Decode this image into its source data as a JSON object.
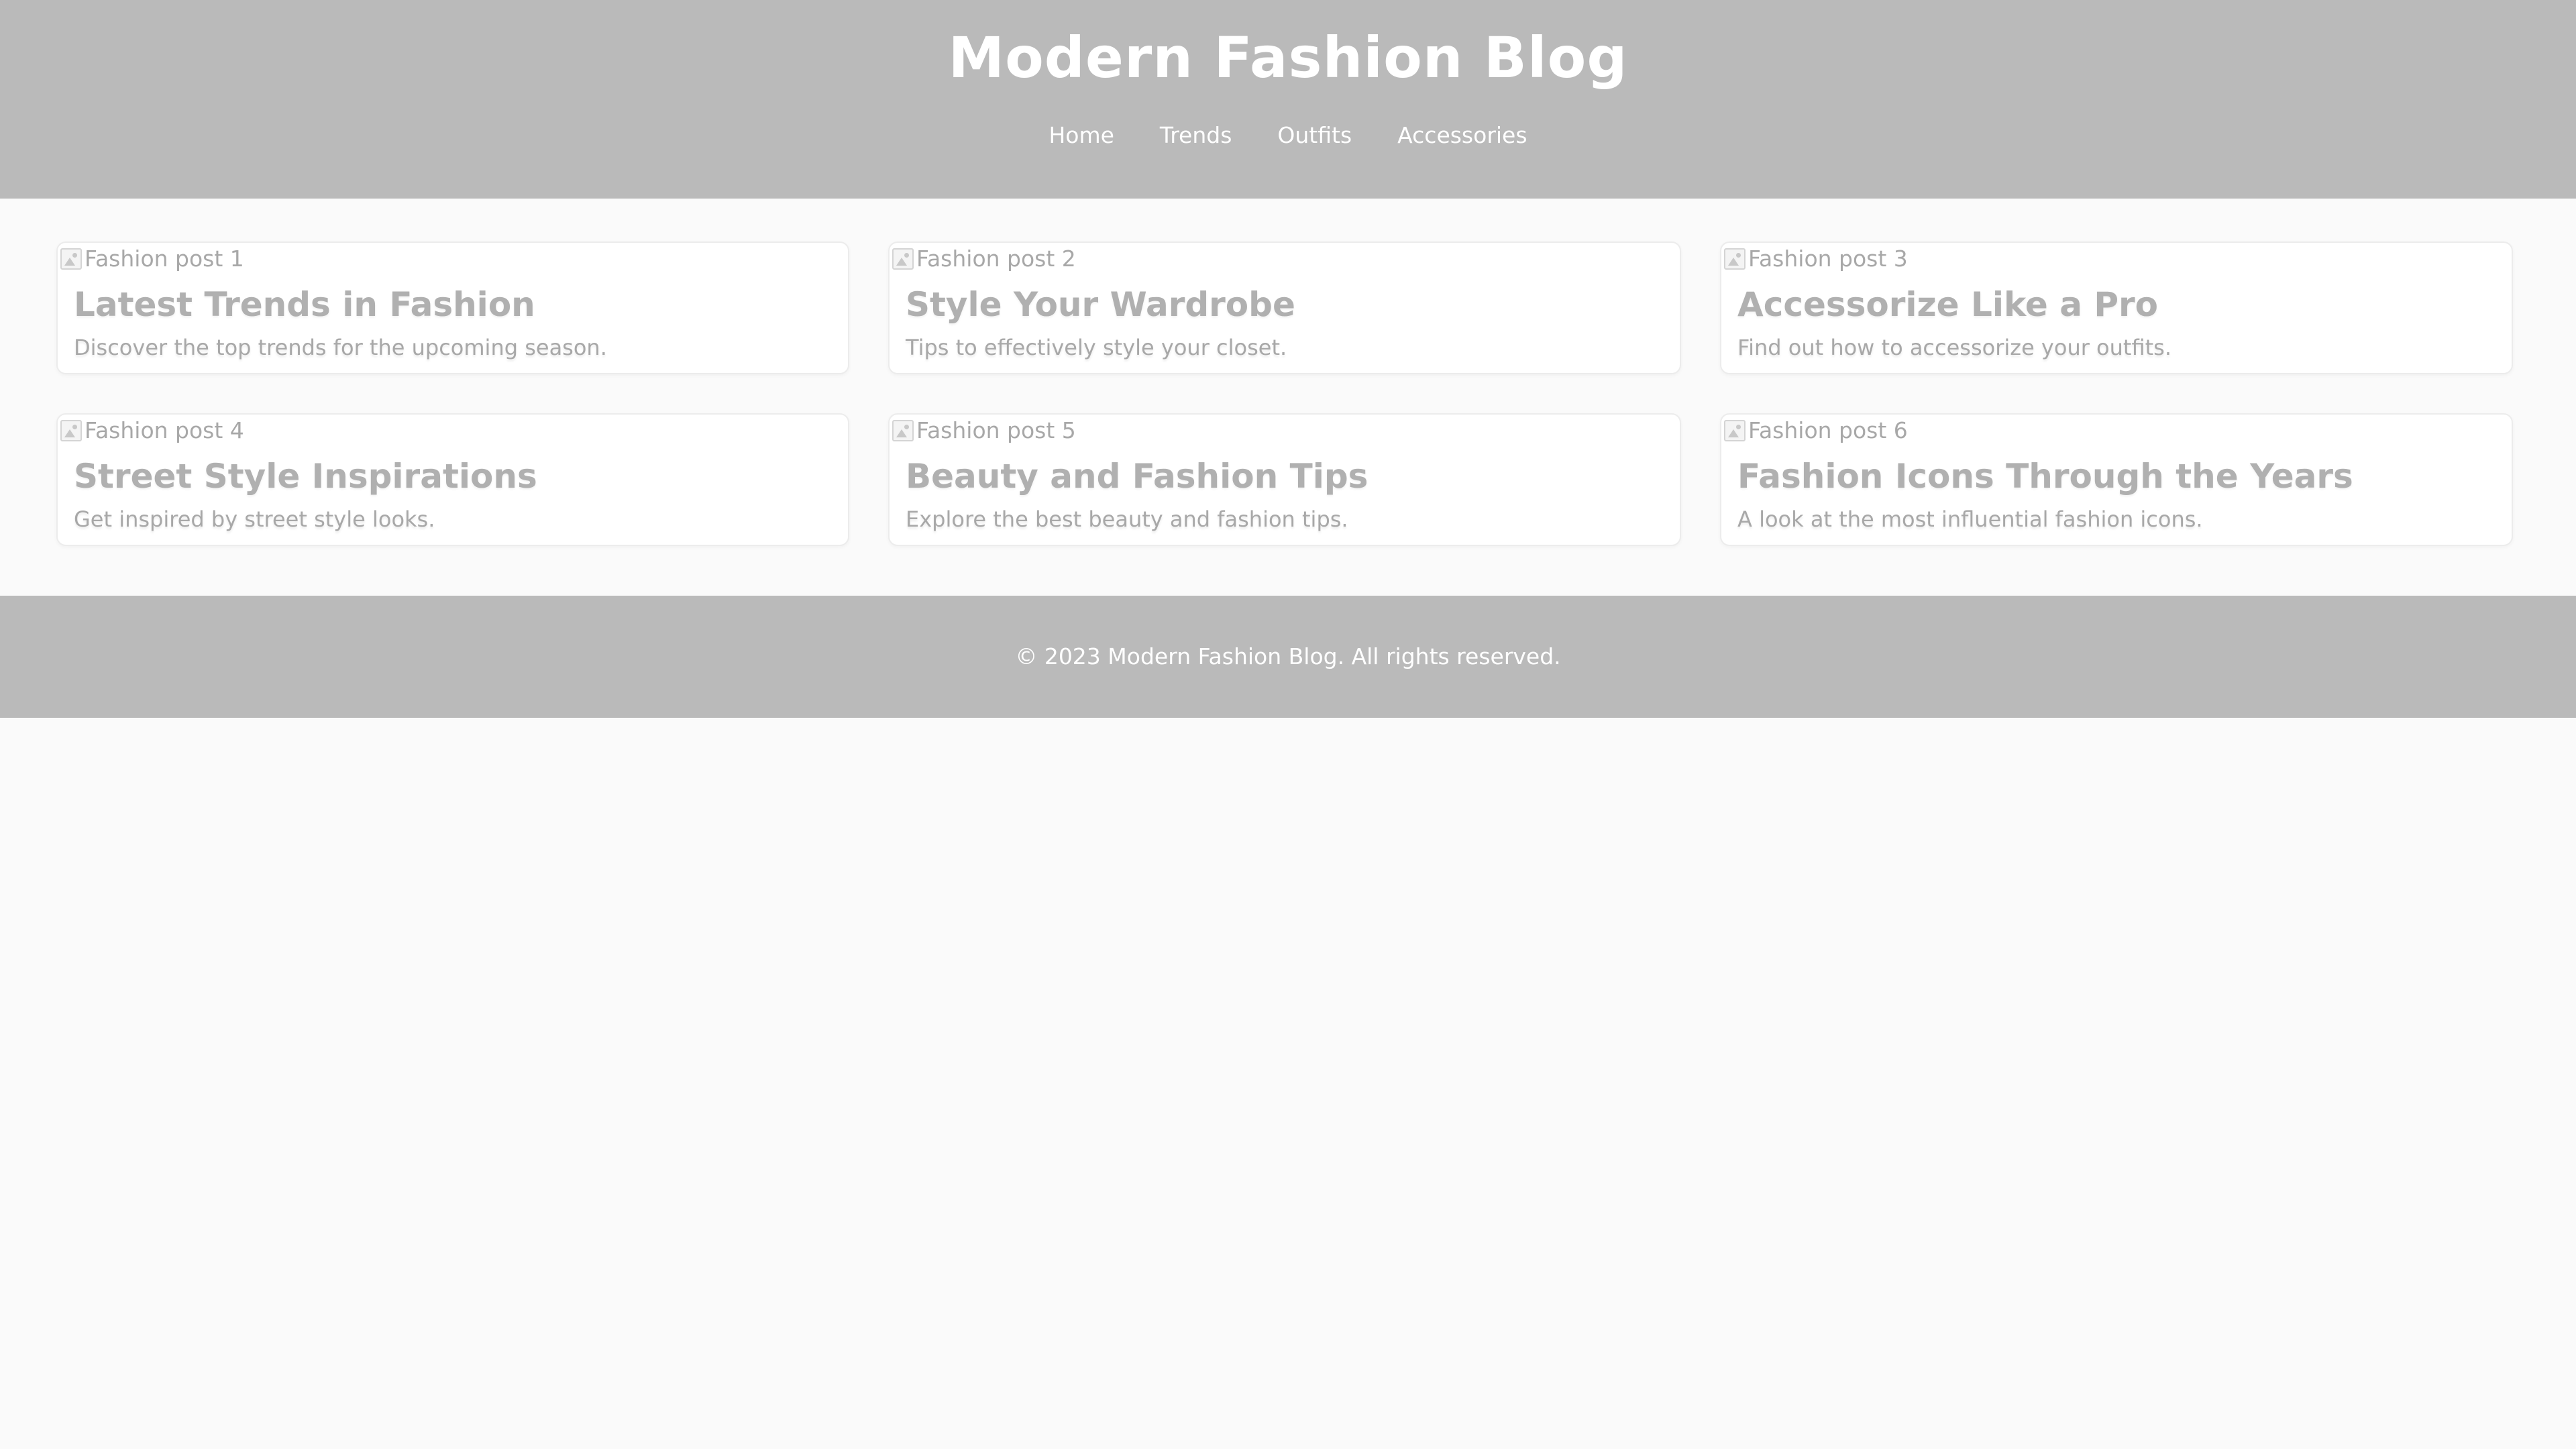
{
  "header": {
    "title": "Modern Fashion Blog",
    "nav": [
      {
        "label": "Home"
      },
      {
        "label": "Trends"
      },
      {
        "label": "Outfits"
      },
      {
        "label": "Accessories"
      }
    ]
  },
  "posts": [
    {
      "image_alt": "Fashion post 1",
      "title": "Latest Trends in Fashion",
      "description": "Discover the top trends for the upcoming season."
    },
    {
      "image_alt": "Fashion post 2",
      "title": "Style Your Wardrobe",
      "description": "Tips to effectively style your closet."
    },
    {
      "image_alt": "Fashion post 3",
      "title": "Accessorize Like a Pro",
      "description": "Find out how to accessorize your outfits."
    },
    {
      "image_alt": "Fashion post 4",
      "title": "Street Style Inspirations",
      "description": "Get inspired by street style looks."
    },
    {
      "image_alt": "Fashion post 5",
      "title": "Beauty and Fashion Tips",
      "description": "Explore the best beauty and fashion tips."
    },
    {
      "image_alt": "Fashion post 6",
      "title": "Fashion Icons Through the Years",
      "description": "A look at the most influential fashion icons."
    }
  ],
  "footer": {
    "text": "© 2023 Modern Fashion Blog. All rights reserved."
  },
  "colors": {
    "header_bg": "#bababa",
    "page_bg": "#fafafa",
    "card_text": "#b0b0b0"
  },
  "icons": {
    "image_placeholder": "broken-image-icon"
  }
}
